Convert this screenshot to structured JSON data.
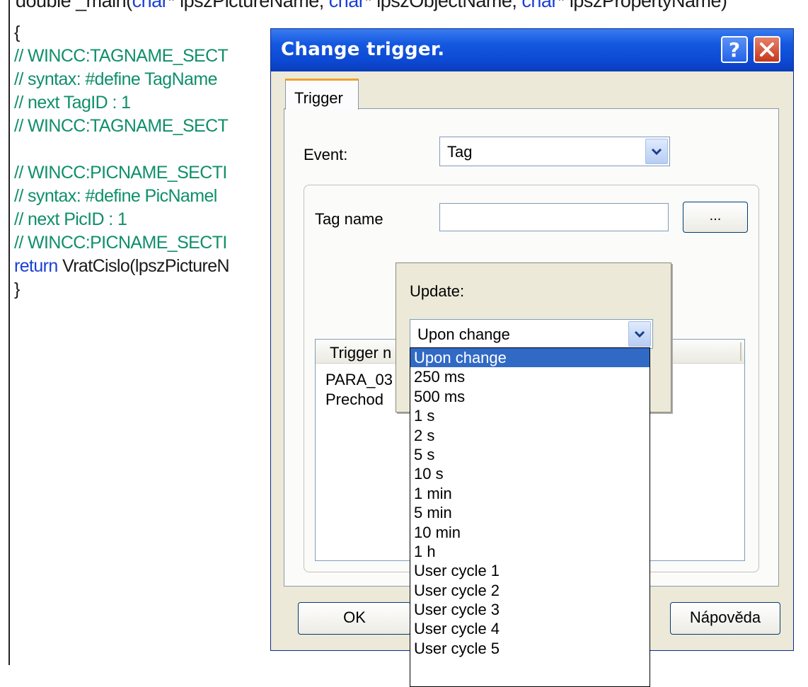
{
  "editor": {
    "top_line": {
      "before1": "double _main(",
      "kw1": "char",
      "mid1": "* lpszPictureName, ",
      "kw2": "char",
      "mid2": "* lpszObjectName, ",
      "kw3": "char",
      "mid3": "* lpszPropertyName)"
    },
    "lines": [
      "{",
      "// WINCC:TAGNAME_SECT",
      "// syntax: #define TagName",
      "// next TagID : 1",
      "// WINCC:TAGNAME_SECT",
      "",
      "// WINCC:PICNAME_SECTI",
      "// syntax: #define PicNamel",
      "// next PicID : 1",
      "// WINCC:PICNAME_SECTI",
      "return",
      "}"
    ],
    "return_rest": " VratCislo(lpszPictureN"
  },
  "dialog": {
    "title": "Change trigger.",
    "help_glyph": "?",
    "tab_label": "Trigger",
    "event_label": "Event:",
    "event_value": "Tag",
    "tagname_label": "Tag name",
    "tagname_value": "",
    "browse_label": "...",
    "update_label": "Update:",
    "update_value": "Upon change",
    "list_header": "Trigger n",
    "list_rows": [
      "PARA_03",
      "Prechod"
    ],
    "update_options": [
      "Upon change",
      "250 ms",
      "500 ms",
      "1 s",
      "2 s",
      "5 s",
      "10 s",
      "1 min",
      "5 min",
      "10 min",
      "1 h",
      "User cycle 1",
      "User cycle 2",
      "User cycle 3",
      "User cycle 4",
      "User cycle 5"
    ],
    "ok_label": "OK",
    "help_label": "Nápověda"
  },
  "colors": {
    "title_bar": "#0c47d0",
    "selection": "#316ac5",
    "comment": "#0f8f6a",
    "keyword": "#1a3fd6"
  }
}
